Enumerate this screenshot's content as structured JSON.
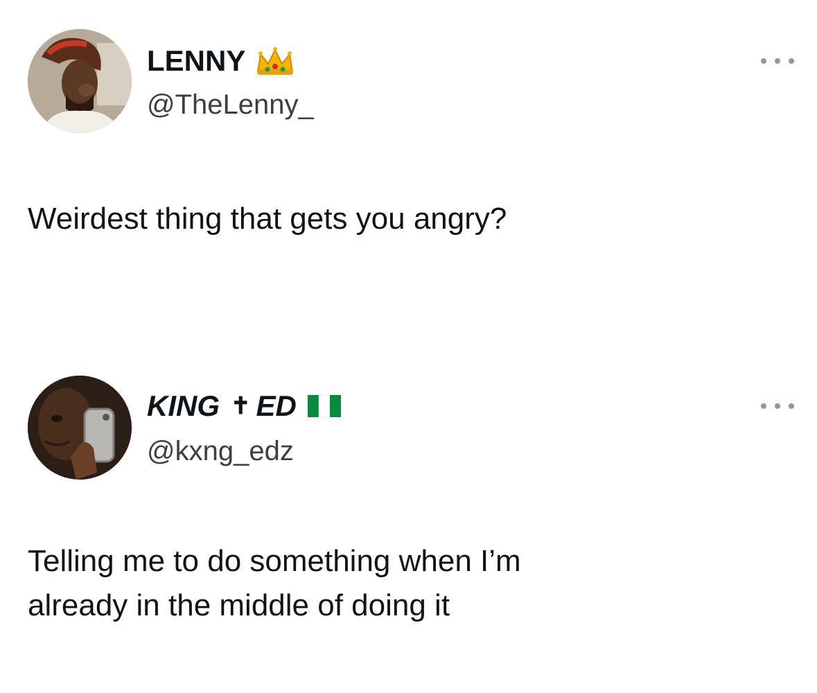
{
  "tweets": [
    {
      "display_name": "LENNY",
      "name_emoji_icon": "crown-emoji",
      "handle": "@TheLenny_",
      "text_lines": [
        "Weirdest thing that gets you angry?"
      ]
    },
    {
      "display_name_part1": "KING ",
      "display_name_cross": "✝",
      "display_name_part2": "ED",
      "name_emoji_icon": "nigeria-flag-emoji",
      "handle": "@kxng_edz",
      "text_lines": [
        "Telling me to do something when I’m",
        "already in the middle of doing it"
      ]
    }
  ],
  "colors": {
    "text": "#0f1419",
    "handle": "#3b3f44",
    "more_dots": "#8b98a5",
    "background": "#ffffff"
  }
}
